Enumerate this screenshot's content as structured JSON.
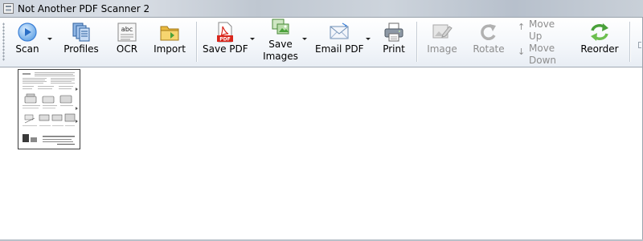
{
  "window": {
    "title": "Not Another PDF Scanner 2"
  },
  "toolbar": {
    "scan": "Scan",
    "profiles": "Profiles",
    "ocr": "OCR",
    "ocr_icon_text": "abc",
    "import": "Import",
    "save_pdf": "Save PDF",
    "save_pdf_icon_text": "PDF",
    "save_images_line1": "Save",
    "save_images_line2": "Images",
    "email_pdf": "Email PDF",
    "print": "Print",
    "image": "Image",
    "rotate": "Rotate",
    "move_up_line1": "Move",
    "move_up_line2": "Up",
    "move_down_line1": "Move",
    "move_down_line2": "Down",
    "reorder": "Reorder"
  },
  "content": {
    "page_count": 1
  },
  "colors": {
    "accent_blue": "#3b7fd6",
    "pdf_red": "#d9261c",
    "reorder_green": "#4aa13a",
    "folder_yellow": "#e9b93f",
    "disabled_gray": "#8d8d8d"
  }
}
